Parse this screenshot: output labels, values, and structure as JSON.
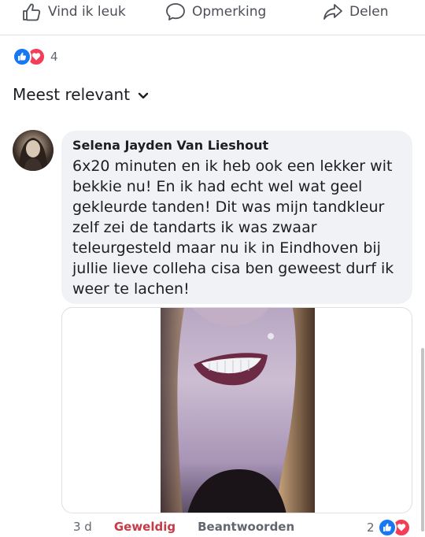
{
  "actions": {
    "like_label": "Vind ik leuk",
    "comment_label": "Opmerking",
    "share_label": "Delen"
  },
  "reactions": {
    "count": "4",
    "icons": [
      "like-icon",
      "love-icon"
    ]
  },
  "sort": {
    "label": "Meest relevant"
  },
  "comment": {
    "author": "Selena Jayden Van Lieshout",
    "text": "6x20 minuten en ik heb ook een lekker wit bekkie nu! En ik had echt wel wat geel gekleurde tanden! Dit was mijn tandkleur zelf zei de tandarts ik was zwaar teleurgesteld maar nu ik in Eindhoven bij jullie lieve colleha cisa ben geweest durf ik weer te lachen!",
    "time": "3 d",
    "reaction_label": "Geweldig",
    "reply_label": "Beantwoorden",
    "reaction_count": "2"
  },
  "colors": {
    "accent_blue": "#1877f2",
    "love_red": "#f33e58",
    "geweldig_red": "#c53b46"
  }
}
